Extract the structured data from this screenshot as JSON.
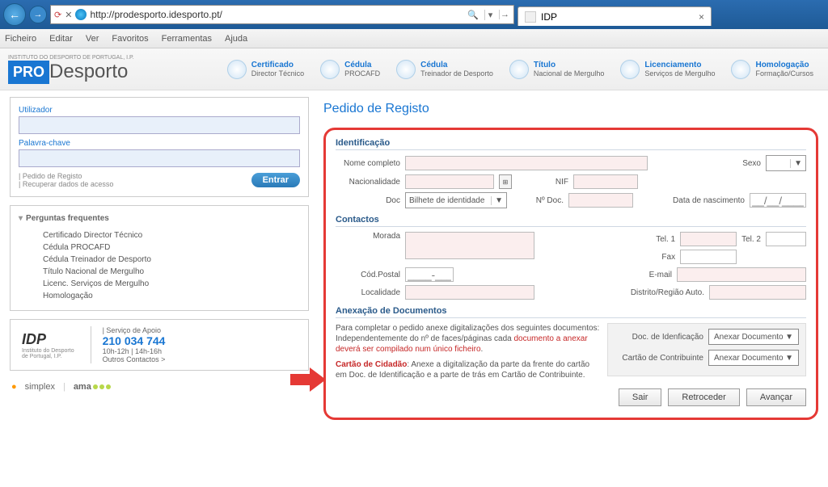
{
  "browser": {
    "url": "http://prodesporto.idesporto.pt/",
    "tab_title": "IDP",
    "menu": [
      "Ficheiro",
      "Editar",
      "Ver",
      "Favoritos",
      "Ferramentas",
      "Ajuda"
    ]
  },
  "logo": {
    "pro": "PRO",
    "desporto": "Desporto",
    "sub": "INSTITUTO DO DESPORTO DE PORTUGAL, I.P."
  },
  "nav": [
    {
      "t1": "Certificado",
      "t2": "Director Técnico"
    },
    {
      "t1": "Cédula",
      "t2": "PROCAFD"
    },
    {
      "t1": "Cédula",
      "t2": "Treinador de Desporto"
    },
    {
      "t1": "Título",
      "t2": "Nacional de Mergulho"
    },
    {
      "t1": "Licenciamento",
      "t2": "Serviços de Mergulho"
    },
    {
      "t1": "Homologação",
      "t2": "Formação/Cursos"
    }
  ],
  "login": {
    "user_label": "Utilizador",
    "pass_label": "Palavra-chave",
    "link1": "| Pedido de Registo",
    "link2": "| Recuperar dados de acesso",
    "entrar": "Entrar"
  },
  "faq": {
    "title": "Perguntas frequentes",
    "items": [
      "Certificado Director Técnico",
      "Cédula PROCAFD",
      "Cédula Treinador de Desporto",
      "Título Nacional de Mergulho",
      "Licenc. Serviços de Mergulho",
      "Homologação"
    ]
  },
  "apoio": {
    "title": "| Serviço de Apoio",
    "tel": "210 034 744",
    "hours": "10h-12h | 14h-16h",
    "more": "Outros Contactos >",
    "idp_name": "IDP",
    "idp_sub1": "Instituto do Desporto",
    "idp_sub2": "de Portugal, I.P."
  },
  "partners": {
    "p1": "simplex",
    "p2": "ama"
  },
  "main_title": "Pedido de Registo",
  "sections": {
    "ident": "Identificação",
    "contactos": "Contactos",
    "anexo": "Anexação de Documentos"
  },
  "labels": {
    "nome": "Nome completo",
    "sexo": "Sexo",
    "nacion": "Nacionalidade",
    "nif": "NIF",
    "doc": "Doc",
    "doc_val": "Bilhete de identidade",
    "ndoc": "Nº Doc.",
    "dnasc": "Data de nascimento",
    "dnasc_ph": "__/__/____",
    "morada": "Morada",
    "tel1": "Tel. 1",
    "tel2": "Tel. 2",
    "fax": "Fax",
    "cpostal": "Cód.Postal",
    "cpostal_ph": "____-___",
    "email": "E-mail",
    "localidade": "Localidade",
    "distrito": "Distrito/Região Auto."
  },
  "anexo": {
    "intro": "Para completar o pedido anexe digitalizações dos seguintes documentos:",
    "warn1": "Independentemente do nº de faces/páginas cada ",
    "warn2": "documento a anexar deverá ser compilado num único ficheiro",
    "warn3": ".",
    "cc_bold": "Cartão de Cidadão",
    "cc_rest": ": Anexe a digitalização da parte da frente do cartão em Doc. de Identificação e a parte de trás em Cartão de Contribuinte.",
    "doc_ident": "Doc. de Idenficação",
    "cartao": "Cartão de Contribuinte",
    "anexar": "Anexar Documento"
  },
  "buttons": {
    "sair": "Sair",
    "retro": "Retroceder",
    "avancar": "Avançar"
  }
}
